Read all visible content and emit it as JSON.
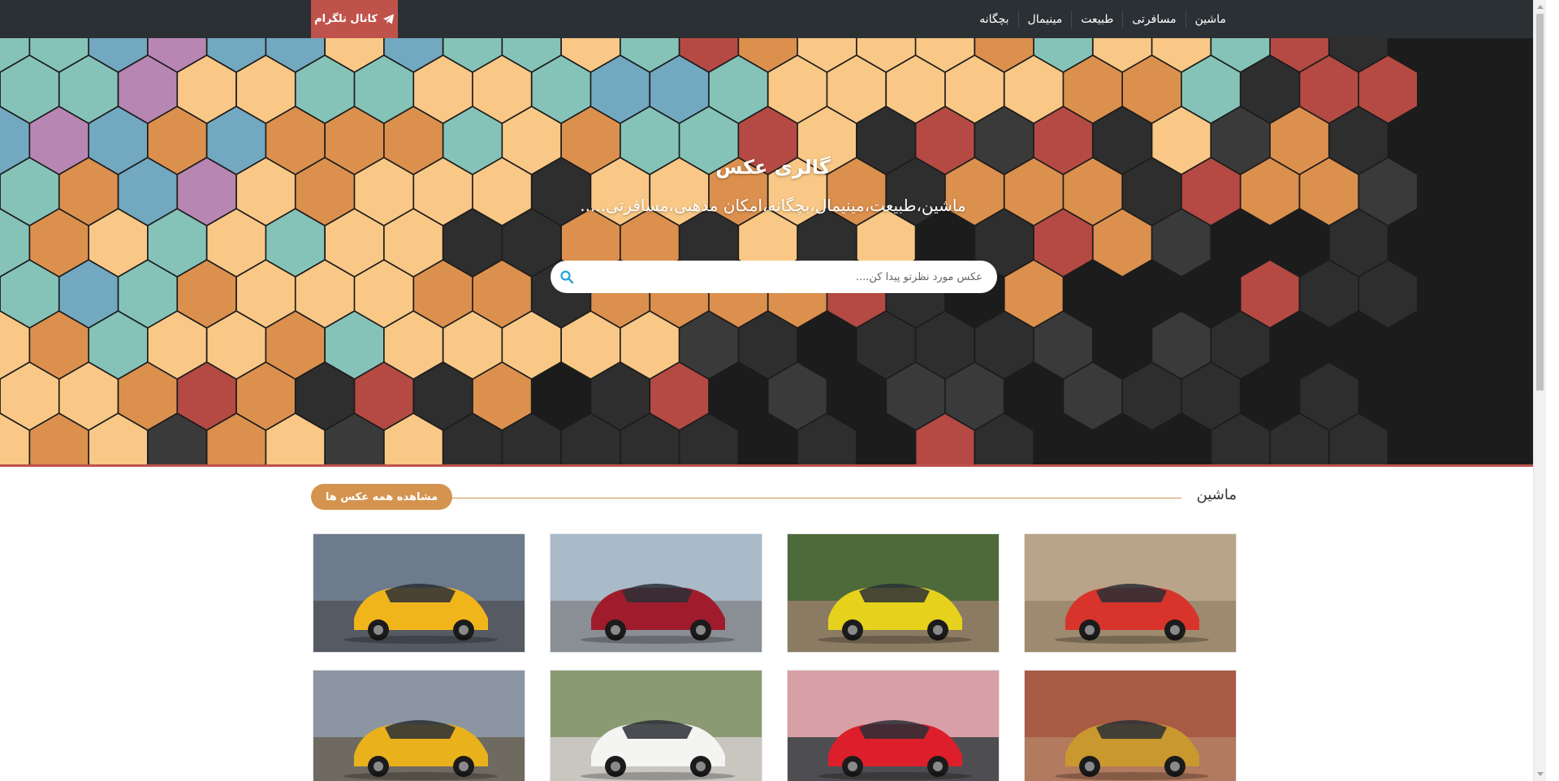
{
  "nav": {
    "items": [
      {
        "label": "ماشین"
      },
      {
        "label": "مسافرتی"
      },
      {
        "label": "طبیعت"
      },
      {
        "label": "مینیمال"
      },
      {
        "label": "بچگانه"
      }
    ],
    "telegram_label": "کانال تلگرام",
    "telegram_icon": "paper-plane-icon"
  },
  "hero": {
    "title": "گالری عکس",
    "subtitle": "ماشین،طبیعت،مینیمال،بچگانه،امکان مذهبی،مسافرتی.....",
    "search_placeholder": "عکس مورد نظرتو پیدا کن....",
    "search_icon": "search-icon"
  },
  "section": {
    "title": "ماشین",
    "view_all_label": "مشاهده همه عکس ها"
  },
  "gallery": {
    "images": [
      {
        "name": "red-coupe-rear",
        "car": "#d8342c",
        "bg": "#b9a489",
        "ground": "#9e8a6e"
      },
      {
        "name": "yellow-6x6-offroad",
        "car": "#e6d21d",
        "bg": "#4e6a3a",
        "ground": "#8c7b63"
      },
      {
        "name": "red-luxury-coupe",
        "car": "#a01c2c",
        "bg": "#a9bac8",
        "ground": "#8a8f96"
      },
      {
        "name": "yellow-muscle-car",
        "car": "#f1b51c",
        "bg": "#6e7b8c",
        "ground": "#555a63"
      },
      {
        "name": "gold-suv-desert",
        "car": "#c9982e",
        "bg": "#a85a44",
        "ground": "#b27a5f"
      },
      {
        "name": "red-sports-car",
        "car": "#dc1f2a",
        "bg": "#d8a0a6",
        "ground": "#4e4e52"
      },
      {
        "name": "white-sedan",
        "car": "#f4f4f2",
        "bg": "#8a9a72",
        "ground": "#c9c6c0"
      },
      {
        "name": "yellow-sports-coupe",
        "car": "#e9b21c",
        "bg": "#8c96a2",
        "ground": "#6f6a60"
      }
    ]
  },
  "colors": {
    "navbar": "#2b3035",
    "telegram": "#c0524c",
    "accent": "#d4944f",
    "hex_palette": [
      "#f9c886",
      "#dc904e",
      "#85c3b8",
      "#72a8c0",
      "#b886b2",
      "#b44a43",
      "#2e2e2e",
      "#3a3a3a",
      "#1c1c1c"
    ]
  }
}
